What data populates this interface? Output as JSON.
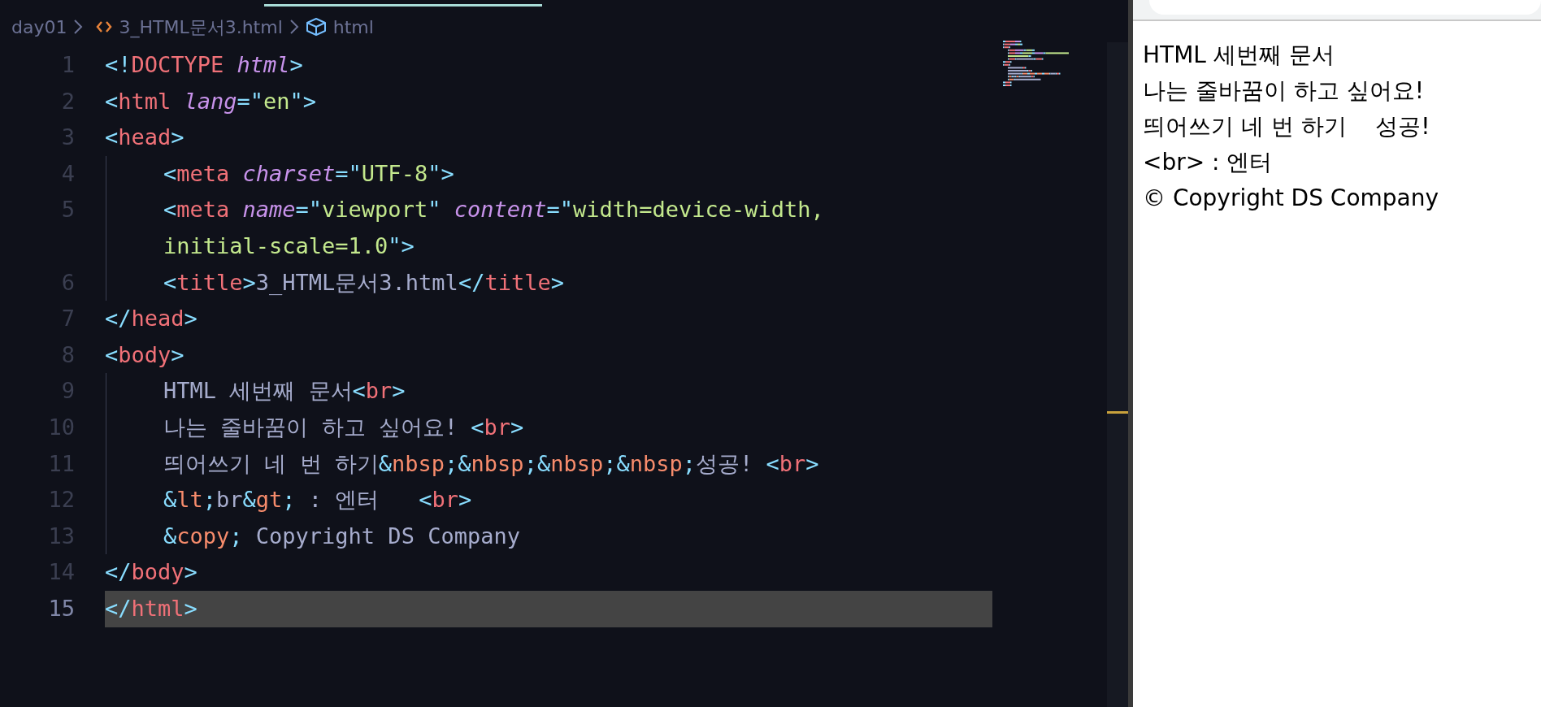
{
  "breadcrumb": {
    "folder": "day01",
    "file": "3_HTML문서3.html",
    "symbol": "html"
  },
  "code_lines": [
    {
      "number": "1",
      "current": false,
      "guide": false,
      "tokens": [
        {
          "kind": "punct",
          "text": "<!"
        },
        {
          "kind": "tag",
          "text": "DOCTYPE "
        },
        {
          "kind": "attr",
          "text": "html"
        },
        {
          "kind": "punct",
          "text": ">"
        }
      ]
    },
    {
      "number": "2",
      "current": false,
      "guide": false,
      "tokens": [
        {
          "kind": "punct",
          "text": "<"
        },
        {
          "kind": "tag",
          "text": "html "
        },
        {
          "kind": "attr",
          "text": "lang"
        },
        {
          "kind": "punct",
          "text": "=\""
        },
        {
          "kind": "string",
          "text": "en"
        },
        {
          "kind": "punct",
          "text": "\">"
        }
      ]
    },
    {
      "number": "3",
      "current": false,
      "guide": false,
      "tokens": [
        {
          "kind": "punct",
          "text": "<"
        },
        {
          "kind": "tag",
          "text": "head"
        },
        {
          "kind": "punct",
          "text": ">"
        }
      ]
    },
    {
      "number": "4",
      "current": false,
      "guide": true,
      "tokens": [
        {
          "kind": "punct",
          "text": "<"
        },
        {
          "kind": "tag",
          "text": "meta "
        },
        {
          "kind": "attr",
          "text": "charset"
        },
        {
          "kind": "punct",
          "text": "=\""
        },
        {
          "kind": "string",
          "text": "UTF-8"
        },
        {
          "kind": "punct",
          "text": "\">"
        }
      ]
    },
    {
      "number": "5",
      "current": false,
      "guide": true,
      "tokens": [
        {
          "kind": "punct",
          "text": "<"
        },
        {
          "kind": "tag",
          "text": "meta "
        },
        {
          "kind": "attr",
          "text": "name"
        },
        {
          "kind": "punct",
          "text": "=\""
        },
        {
          "kind": "string",
          "text": "viewport"
        },
        {
          "kind": "punct",
          "text": "\" "
        },
        {
          "kind": "attr",
          "text": "content"
        },
        {
          "kind": "punct",
          "text": "=\""
        },
        {
          "kind": "string",
          "text": "width=device-width,"
        }
      ]
    },
    {
      "current": false,
      "guide": true,
      "tokens": [
        {
          "kind": "string",
          "text": "initial-scale=1.0"
        },
        {
          "kind": "punct",
          "text": "\">"
        }
      ]
    },
    {
      "number": "6",
      "current": false,
      "guide": true,
      "tokens": [
        {
          "kind": "punct",
          "text": "<"
        },
        {
          "kind": "tag",
          "text": "title"
        },
        {
          "kind": "punct",
          "text": ">"
        },
        {
          "kind": "text",
          "text": "3_HTML문서3.html"
        },
        {
          "kind": "punct",
          "text": "</"
        },
        {
          "kind": "tag",
          "text": "title"
        },
        {
          "kind": "punct",
          "text": ">"
        }
      ]
    },
    {
      "number": "7",
      "current": false,
      "guide": false,
      "tokens": [
        {
          "kind": "punct",
          "text": "</"
        },
        {
          "kind": "tag",
          "text": "head"
        },
        {
          "kind": "punct",
          "text": ">"
        }
      ]
    },
    {
      "number": "8",
      "current": false,
      "guide": false,
      "tokens": [
        {
          "kind": "punct",
          "text": "<"
        },
        {
          "kind": "tag",
          "text": "body"
        },
        {
          "kind": "punct",
          "text": ">"
        }
      ]
    },
    {
      "number": "9",
      "current": false,
      "guide": true,
      "tokens": [
        {
          "kind": "text",
          "text": "HTML 세번째 문서"
        },
        {
          "kind": "punct",
          "text": "<"
        },
        {
          "kind": "tag",
          "text": "br"
        },
        {
          "kind": "punct",
          "text": ">"
        }
      ]
    },
    {
      "number": "10",
      "current": false,
      "guide": true,
      "tokens": [
        {
          "kind": "text",
          "text": "나는 줄바꿈이 하고 싶어요! "
        },
        {
          "kind": "punct",
          "text": "<"
        },
        {
          "kind": "tag",
          "text": "br"
        },
        {
          "kind": "punct",
          "text": ">"
        }
      ]
    },
    {
      "number": "11",
      "current": false,
      "guide": true,
      "tokens": [
        {
          "kind": "text",
          "text": "띄어쓰기 네 번 하기"
        },
        {
          "kind": "punct",
          "text": "&"
        },
        {
          "kind": "entity",
          "text": "nbsp"
        },
        {
          "kind": "punct",
          "text": ";&"
        },
        {
          "kind": "entity",
          "text": "nbsp"
        },
        {
          "kind": "punct",
          "text": ";&"
        },
        {
          "kind": "entity",
          "text": "nbsp"
        },
        {
          "kind": "punct",
          "text": ";&"
        },
        {
          "kind": "entity",
          "text": "nbsp"
        },
        {
          "kind": "punct",
          "text": ";"
        },
        {
          "kind": "text",
          "text": "성공! "
        },
        {
          "kind": "punct",
          "text": "<"
        },
        {
          "kind": "tag",
          "text": "br"
        },
        {
          "kind": "punct",
          "text": ">"
        }
      ]
    },
    {
      "number": "12",
      "current": false,
      "guide": true,
      "tokens": [
        {
          "kind": "punct",
          "text": "&"
        },
        {
          "kind": "entity",
          "text": "lt"
        },
        {
          "kind": "punct",
          "text": ";"
        },
        {
          "kind": "text",
          "text": "br"
        },
        {
          "kind": "punct",
          "text": "&"
        },
        {
          "kind": "entity",
          "text": "gt"
        },
        {
          "kind": "punct",
          "text": ";"
        },
        {
          "kind": "text",
          "text": " : 엔터   "
        },
        {
          "kind": "punct",
          "text": "<"
        },
        {
          "kind": "tag",
          "text": "br"
        },
        {
          "kind": "punct",
          "text": ">"
        }
      ]
    },
    {
      "number": "13",
      "current": false,
      "guide": true,
      "tokens": [
        {
          "kind": "punct",
          "text": "&"
        },
        {
          "kind": "entity",
          "text": "copy"
        },
        {
          "kind": "punct",
          "text": ";"
        },
        {
          "kind": "text",
          "text": " Copyright DS Company"
        }
      ]
    },
    {
      "number": "14",
      "current": false,
      "guide": false,
      "tokens": [
        {
          "kind": "punct",
          "text": "</"
        },
        {
          "kind": "tag",
          "text": "body"
        },
        {
          "kind": "punct",
          "text": ">"
        }
      ]
    },
    {
      "number": "15",
      "current": true,
      "guide": false,
      "tokens": [
        {
          "kind": "punct",
          "text": "</"
        },
        {
          "kind": "tag",
          "text": "html"
        },
        {
          "kind": "punct",
          "text": ">"
        }
      ]
    }
  ],
  "preview_lines": [
    "HTML 세번째 문서",
    "나는 줄바꿈이 하고 싶어요!",
    "띄어쓰기 네 번 하기    성공!",
    "<br> : 엔터",
    "© Copyright DS Company"
  ]
}
